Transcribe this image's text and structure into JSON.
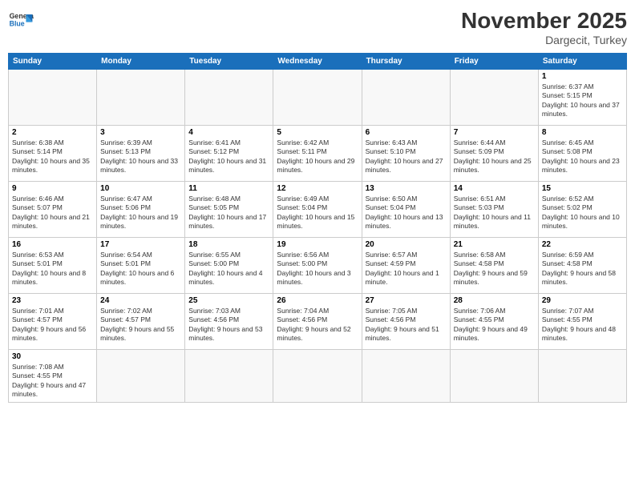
{
  "logo": {
    "text_general": "General",
    "text_blue": "Blue"
  },
  "header": {
    "month": "November 2025",
    "location": "Dargecit, Turkey"
  },
  "weekdays": [
    "Sunday",
    "Monday",
    "Tuesday",
    "Wednesday",
    "Thursday",
    "Friday",
    "Saturday"
  ],
  "days": [
    {
      "num": "",
      "info": ""
    },
    {
      "num": "",
      "info": ""
    },
    {
      "num": "",
      "info": ""
    },
    {
      "num": "",
      "info": ""
    },
    {
      "num": "",
      "info": ""
    },
    {
      "num": "",
      "info": ""
    },
    {
      "num": "1",
      "info": "Sunrise: 6:37 AM\nSunset: 5:15 PM\nDaylight: 10 hours and 37 minutes."
    },
    {
      "num": "2",
      "info": "Sunrise: 6:38 AM\nSunset: 5:14 PM\nDaylight: 10 hours and 35 minutes."
    },
    {
      "num": "3",
      "info": "Sunrise: 6:39 AM\nSunset: 5:13 PM\nDaylight: 10 hours and 33 minutes."
    },
    {
      "num": "4",
      "info": "Sunrise: 6:41 AM\nSunset: 5:12 PM\nDaylight: 10 hours and 31 minutes."
    },
    {
      "num": "5",
      "info": "Sunrise: 6:42 AM\nSunset: 5:11 PM\nDaylight: 10 hours and 29 minutes."
    },
    {
      "num": "6",
      "info": "Sunrise: 6:43 AM\nSunset: 5:10 PM\nDaylight: 10 hours and 27 minutes."
    },
    {
      "num": "7",
      "info": "Sunrise: 6:44 AM\nSunset: 5:09 PM\nDaylight: 10 hours and 25 minutes."
    },
    {
      "num": "8",
      "info": "Sunrise: 6:45 AM\nSunset: 5:08 PM\nDaylight: 10 hours and 23 minutes."
    },
    {
      "num": "9",
      "info": "Sunrise: 6:46 AM\nSunset: 5:07 PM\nDaylight: 10 hours and 21 minutes."
    },
    {
      "num": "10",
      "info": "Sunrise: 6:47 AM\nSunset: 5:06 PM\nDaylight: 10 hours and 19 minutes."
    },
    {
      "num": "11",
      "info": "Sunrise: 6:48 AM\nSunset: 5:05 PM\nDaylight: 10 hours and 17 minutes."
    },
    {
      "num": "12",
      "info": "Sunrise: 6:49 AM\nSunset: 5:04 PM\nDaylight: 10 hours and 15 minutes."
    },
    {
      "num": "13",
      "info": "Sunrise: 6:50 AM\nSunset: 5:04 PM\nDaylight: 10 hours and 13 minutes."
    },
    {
      "num": "14",
      "info": "Sunrise: 6:51 AM\nSunset: 5:03 PM\nDaylight: 10 hours and 11 minutes."
    },
    {
      "num": "15",
      "info": "Sunrise: 6:52 AM\nSunset: 5:02 PM\nDaylight: 10 hours and 10 minutes."
    },
    {
      "num": "16",
      "info": "Sunrise: 6:53 AM\nSunset: 5:01 PM\nDaylight: 10 hours and 8 minutes."
    },
    {
      "num": "17",
      "info": "Sunrise: 6:54 AM\nSunset: 5:01 PM\nDaylight: 10 hours and 6 minutes."
    },
    {
      "num": "18",
      "info": "Sunrise: 6:55 AM\nSunset: 5:00 PM\nDaylight: 10 hours and 4 minutes."
    },
    {
      "num": "19",
      "info": "Sunrise: 6:56 AM\nSunset: 5:00 PM\nDaylight: 10 hours and 3 minutes."
    },
    {
      "num": "20",
      "info": "Sunrise: 6:57 AM\nSunset: 4:59 PM\nDaylight: 10 hours and 1 minute."
    },
    {
      "num": "21",
      "info": "Sunrise: 6:58 AM\nSunset: 4:58 PM\nDaylight: 9 hours and 59 minutes."
    },
    {
      "num": "22",
      "info": "Sunrise: 6:59 AM\nSunset: 4:58 PM\nDaylight: 9 hours and 58 minutes."
    },
    {
      "num": "23",
      "info": "Sunrise: 7:01 AM\nSunset: 4:57 PM\nDaylight: 9 hours and 56 minutes."
    },
    {
      "num": "24",
      "info": "Sunrise: 7:02 AM\nSunset: 4:57 PM\nDaylight: 9 hours and 55 minutes."
    },
    {
      "num": "25",
      "info": "Sunrise: 7:03 AM\nSunset: 4:56 PM\nDaylight: 9 hours and 53 minutes."
    },
    {
      "num": "26",
      "info": "Sunrise: 7:04 AM\nSunset: 4:56 PM\nDaylight: 9 hours and 52 minutes."
    },
    {
      "num": "27",
      "info": "Sunrise: 7:05 AM\nSunset: 4:56 PM\nDaylight: 9 hours and 51 minutes."
    },
    {
      "num": "28",
      "info": "Sunrise: 7:06 AM\nSunset: 4:55 PM\nDaylight: 9 hours and 49 minutes."
    },
    {
      "num": "29",
      "info": "Sunrise: 7:07 AM\nSunset: 4:55 PM\nDaylight: 9 hours and 48 minutes."
    },
    {
      "num": "30",
      "info": "Sunrise: 7:08 AM\nSunset: 4:55 PM\nDaylight: 9 hours and 47 minutes."
    }
  ]
}
